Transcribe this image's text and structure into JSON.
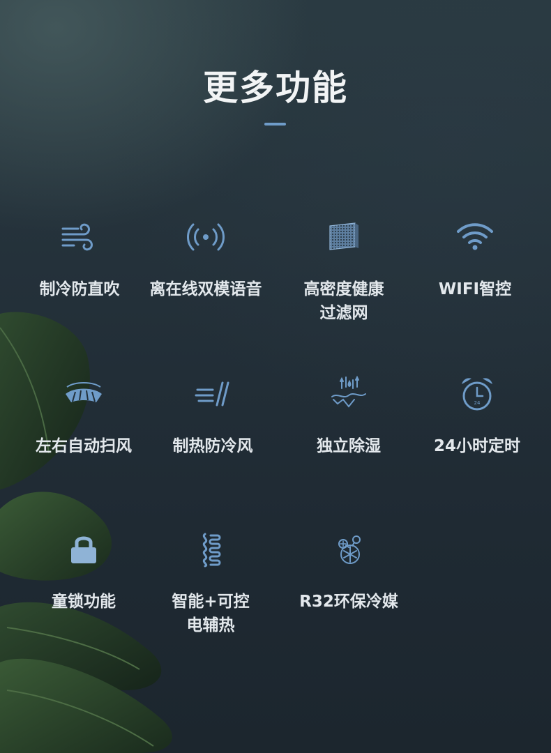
{
  "title": "更多功能",
  "accent_color": "#6f9cc9",
  "features": [
    {
      "label": "制冷防直吹",
      "icon": "wind-icon"
    },
    {
      "label": "离在线双模语音",
      "icon": "voice-signal-icon"
    },
    {
      "label": "高密度健康\n过滤网",
      "icon": "filter-mesh-icon"
    },
    {
      "label": "WIFI智控",
      "icon": "wifi-icon"
    },
    {
      "label": "左右自动扫风",
      "icon": "swing-fan-icon"
    },
    {
      "label": "制热防冷风",
      "icon": "hot-air-icon"
    },
    {
      "label": "独立除湿",
      "icon": "dehumidify-icon"
    },
    {
      "label": "24小时定时",
      "icon": "alarm-clock-icon"
    },
    {
      "label": "童锁功能",
      "icon": "lock-icon"
    },
    {
      "label": "智能+可控\n电辅热",
      "icon": "heating-coil-icon"
    },
    {
      "label": "R32环保冷媒",
      "icon": "refrigerant-icon"
    }
  ]
}
